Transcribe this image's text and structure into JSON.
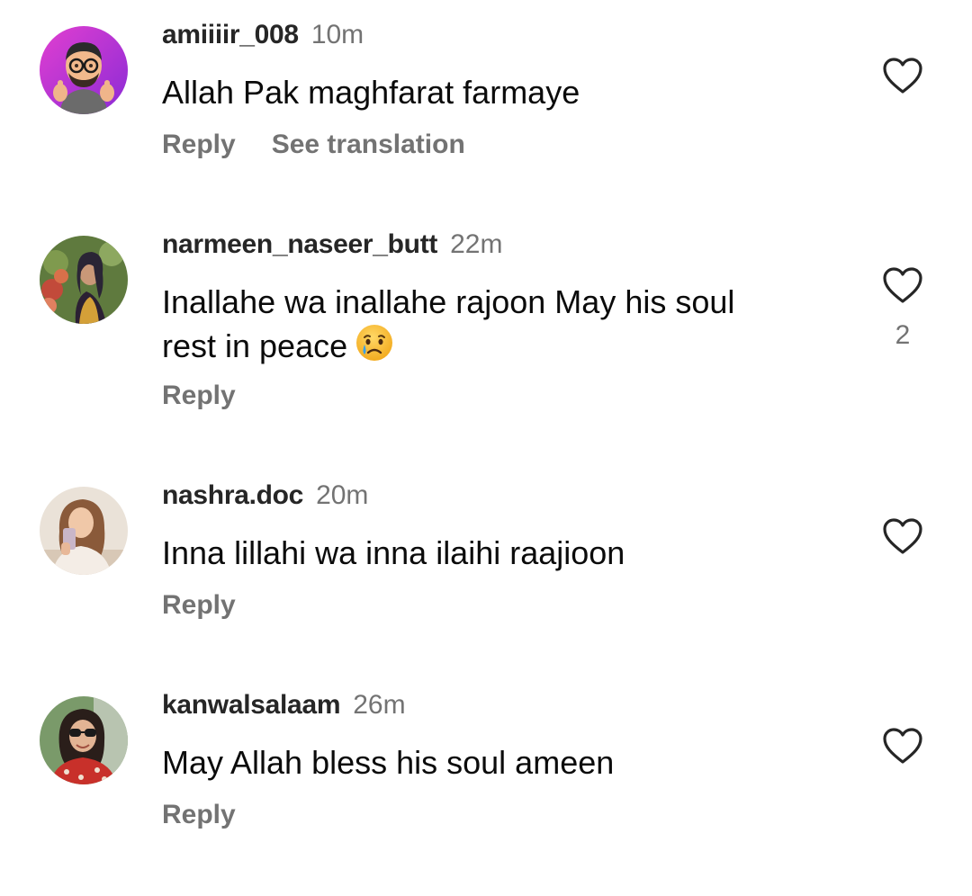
{
  "comments": [
    {
      "username": "amiiiir_008",
      "time": "10m",
      "text": "Allah Pak maghfarat farmaye",
      "reply_label": "Reply",
      "translate_label": "See translation",
      "avatar_icon": "memoji-glasses-thumbs-up-avatar",
      "avatar_bg": "#c03bd6"
    },
    {
      "username": "narmeen_naseer_butt",
      "time": "22m",
      "text_line1": "Inallahe wa inallahe rajoon  May his soul",
      "text_line2": "rest in peace",
      "emoji": "crying-face-emoji",
      "like_count": "2",
      "reply_label": "Reply"
    },
    {
      "username": "nashra.doc",
      "time": "20m",
      "text": "Inna lillahi wa inna ilaihi raajioon",
      "reply_label": "Reply"
    },
    {
      "username": "kanwalsalaam",
      "time": "26m",
      "text": "May Allah bless his soul ameen",
      "reply_label": "Reply"
    }
  ],
  "icons": {
    "like": "heart-outline-icon"
  },
  "colors": {
    "username": "#262626",
    "secondary_text": "#737373",
    "body_text": "#0b0b0b",
    "background": "#ffffff"
  }
}
